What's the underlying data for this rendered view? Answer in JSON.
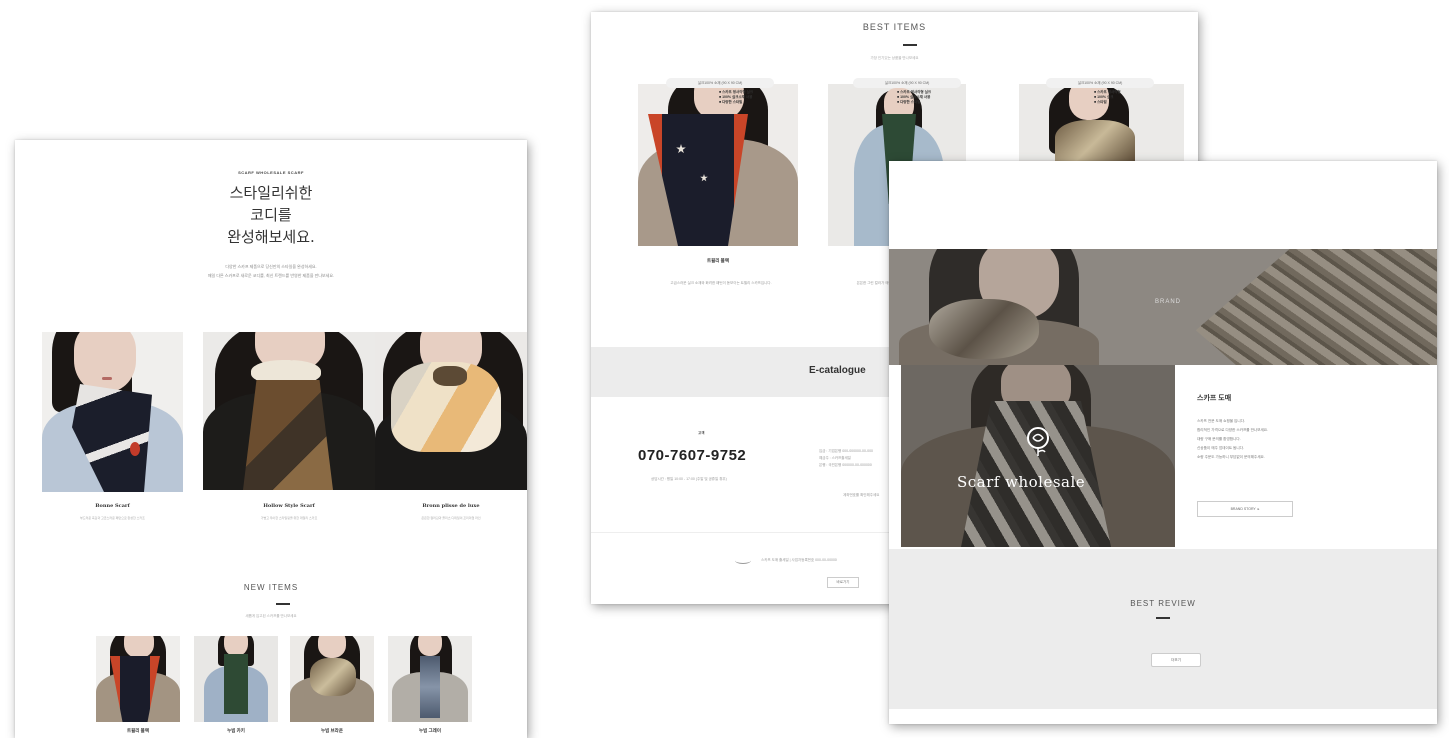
{
  "left_panel": {
    "eyebrow": "SCARF WHOLESALE SCARF",
    "headline_lines": [
      "스타일리쉬한",
      "코디를",
      "완성해보세요."
    ],
    "intro_lines": [
      "다양한 스카프 제품으로 당신만의 스타일을 완성하세요.",
      "매일 다른 스카프로 새로운 코디를, 최신 트렌드를 반영한 제품을 만나보세요."
    ],
    "features": [
      {
        "title": "Bonne Scarf",
        "sub": "부드러운 촉감과 고급스러운 패턴으로 완성한 스카프"
      },
      {
        "title": "Hollow Style Scarf",
        "sub": "가볍고 우아한 스타일링을 위한 데일리 스카프"
      },
      {
        "title": "Bronn plisse de luxe",
        "sub": "은은한 컬러감과 플리츠 디테일의 프리미엄 라인"
      }
    ],
    "new_items_title": "NEW ITEMS",
    "new_items_sub": "새롭게 입고된 스카프를 만나보세요",
    "new_items": [
      "트윌리 블랙",
      "누빔 카키",
      "누빔 브라운",
      "누빔 그레이"
    ]
  },
  "middle_panel": {
    "best_title": "BEST ITEMS",
    "best_sub": "가장 인기있는 상품을 만나보세요",
    "products": [
      {
        "badge": "실크100% 소재 (90 X 90 CM)",
        "tag": [
          "■ 스카프 정사각형 실크",
          "■ 100% 실크소재 사용",
          "■ 다양한 스타일"
        ],
        "name": "트윌리 블랙",
        "desc": "고급스러운 실크 소재와 화려한 패턴이 돋보이는 트윌리 스카프입니다."
      },
      {
        "badge": "실크100% 소재 (90 X 90 CM)",
        "tag": [
          "■ 스카프 정사각형 실크",
          "■ 100% 실크소재 사용",
          "■ 다양한 스타일"
        ],
        "name": "",
        "desc": "은은한 그린 컬러가 매력적인 데일리 스카프"
      },
      {
        "badge": "실크100% 소재 (90 X 90 CM)",
        "tag": [
          "■ 스카프 정사각형",
          "■ 100% 실크",
          "■ 스타일"
        ],
        "name": "",
        "desc": ""
      }
    ],
    "ecatalogue": "E-catalogue",
    "cs_label": "고객",
    "phone": "070-7607-9752",
    "hours": "상담시간 : 평일 10:00 - 17:00 (주말 및 공휴일 휴무)",
    "account_lines": [
      "입금 : 기업은행 000-000000-00-000",
      "예금주 : 스카프홀세일",
      "은행 : 국민은행 000000-00-000000"
    ],
    "account_note": "계좌번호를 확인해주세요",
    "footer_text": "스카프 도매 홀세일 | 사업자등록번호 000-00-00000",
    "footer_button": "바로가기"
  },
  "right_panel": {
    "banner_text": "BRAND",
    "wordmark": "Scarf wholesale",
    "info_title": "스카프 도매",
    "info_lines": [
      "스카프 전문 도매 쇼핑몰 입니다.",
      "합리적인 가격으로 다양한 스카프를 만나보세요.",
      "대량 구매 문의를 환영합니다.",
      "신상품이 매주 업데이트 됩니다.",
      "소량 주문도 가능하니 부담없이 문의해주세요."
    ],
    "info_button": "BRAND STORY",
    "review_title": "BEST REVIEW",
    "review_button": "더보기"
  }
}
